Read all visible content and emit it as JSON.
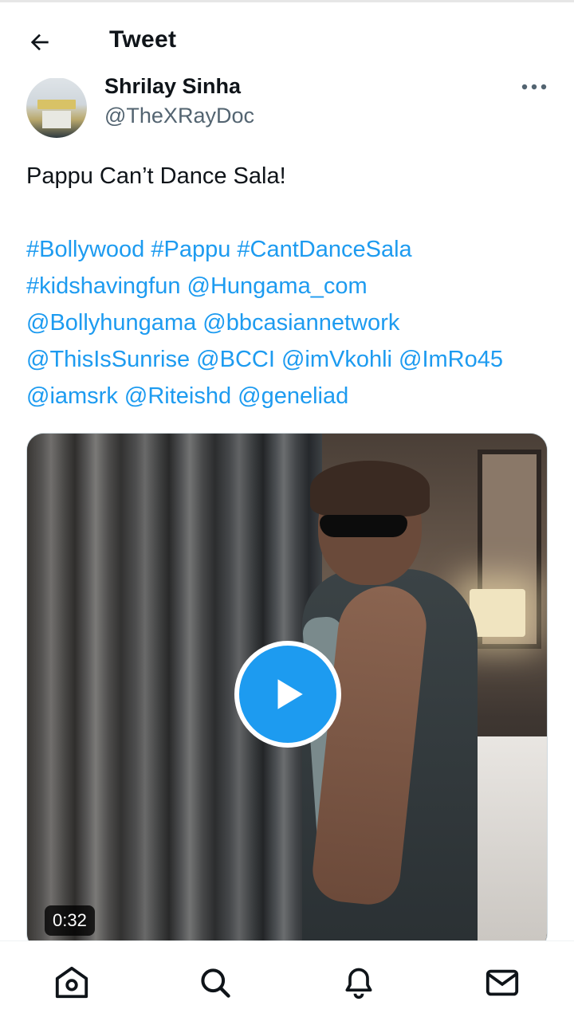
{
  "header": {
    "title": "Tweet"
  },
  "author": {
    "display_name": "Shrilay Sinha",
    "handle": "@TheXRayDoc"
  },
  "tweet": {
    "text": "Pappu Can’t Dance Sala!",
    "tags_lines": [
      "#Bollywood #Pappu #CantDanceSala",
      "#kidshavingfun @Hungama_com",
      "@Bollyhungama @bbcasiannetwork",
      "@ThisIsSunrise @BCCI @imVkohli @ImRo45",
      "@iamsrk @Riteishd @geneliad"
    ]
  },
  "media": {
    "type": "video",
    "duration": "0:32"
  },
  "colors": {
    "accent": "#1d9bf0",
    "text": "#0f1419",
    "secondary": "#536471"
  },
  "bottom_nav": {
    "icons": [
      "home-icon",
      "search-icon",
      "notifications-icon",
      "messages-icon"
    ]
  }
}
